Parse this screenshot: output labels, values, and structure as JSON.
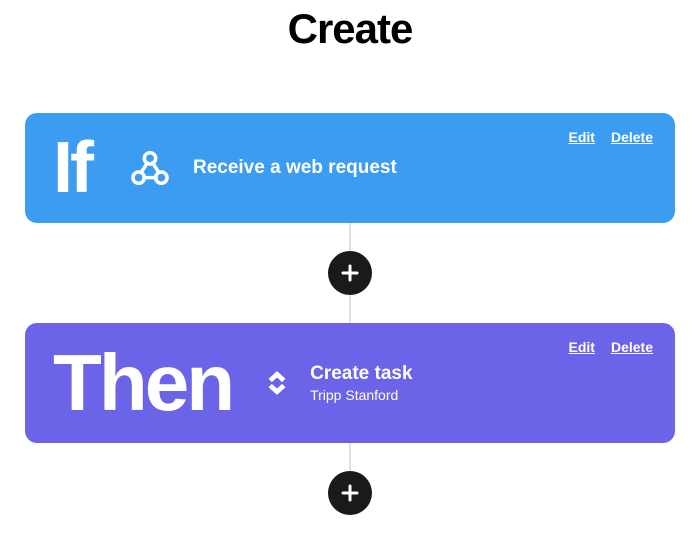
{
  "page_title": "Create",
  "if_card": {
    "keyword": "If",
    "label": "Receive a web request",
    "edit_label": "Edit",
    "delete_label": "Delete",
    "icon": "webhook-icon"
  },
  "then_card": {
    "keyword": "Then",
    "label": "Create task",
    "sub_label": "Tripp Stanford",
    "edit_label": "Edit",
    "delete_label": "Delete",
    "icon": "clickup-icon"
  },
  "colors": {
    "if_bg": "#3B9CF2",
    "then_bg": "#6B63E8",
    "plus_bg": "#1a1a1a"
  }
}
